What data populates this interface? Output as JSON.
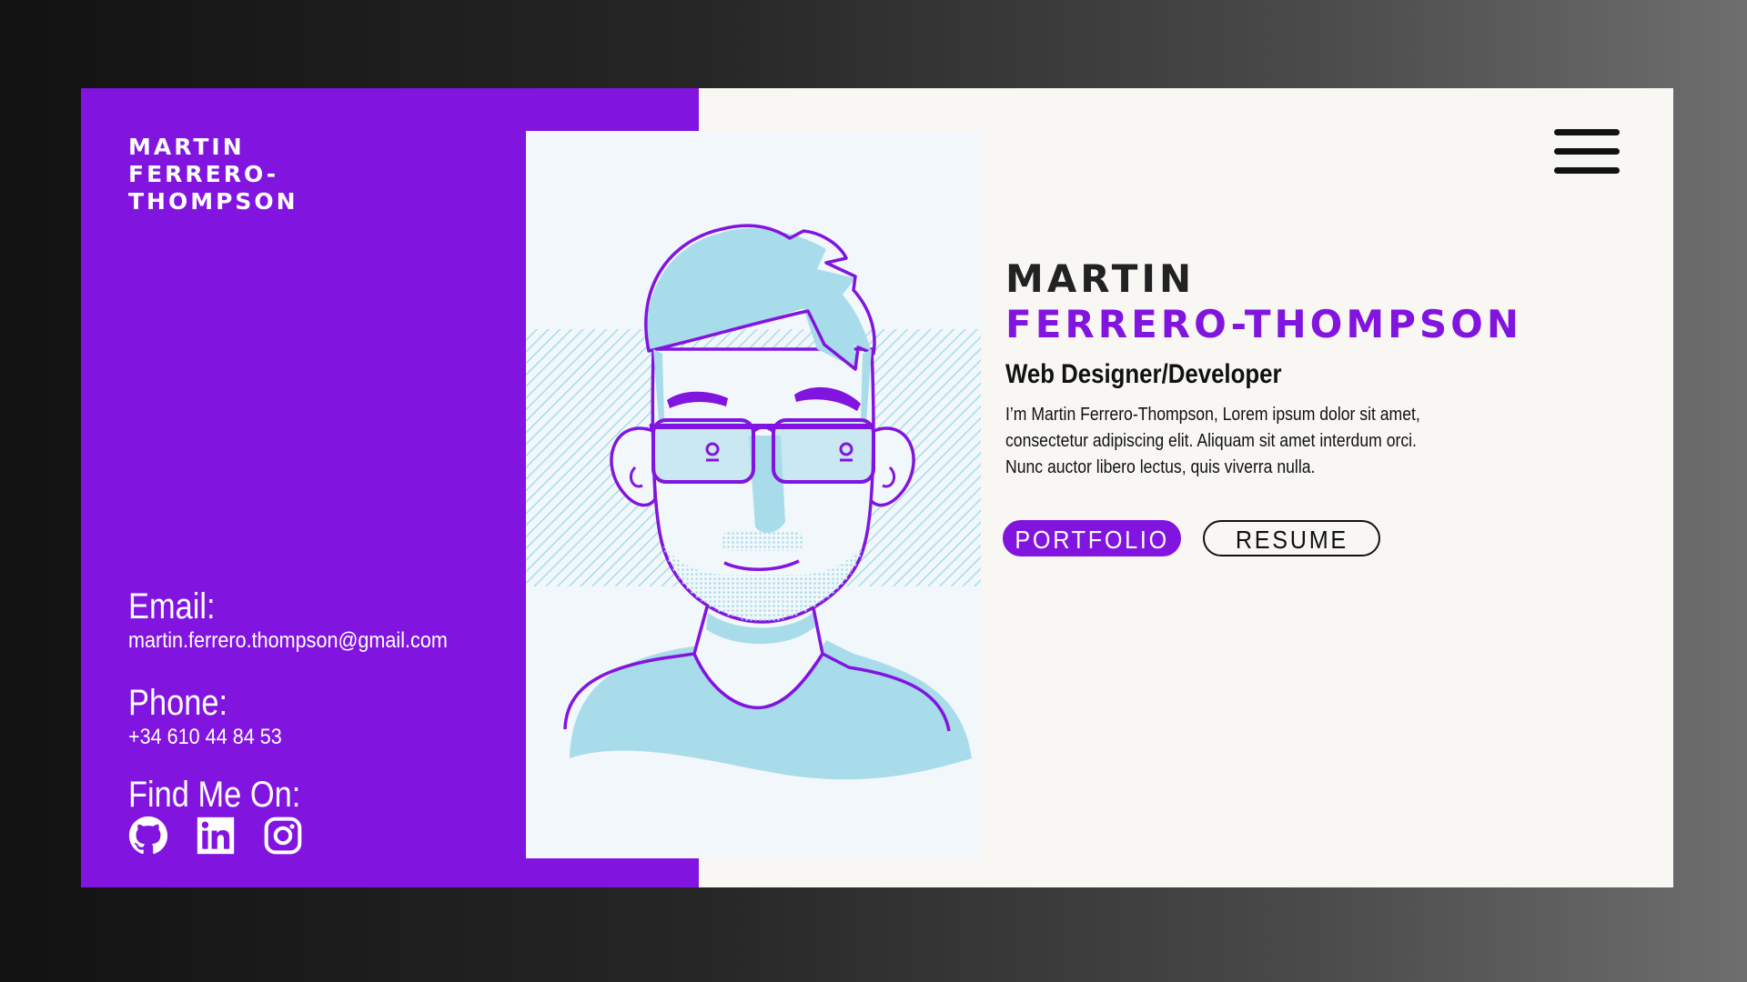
{
  "brand": {
    "name_line1": "MARTIN",
    "name_line2": "FERRERO-",
    "name_line3": "THOMPSON"
  },
  "contact": {
    "email_label": "Email:",
    "email_value": "martin.ferrero.thompson@gmail.com",
    "phone_label": "Phone:",
    "phone_value": "+34 610 44 84 53",
    "find_label": "Find Me On:"
  },
  "social": [
    {
      "icon": "github-icon"
    },
    {
      "icon": "linkedin-icon"
    },
    {
      "icon": "instagram-icon"
    }
  ],
  "hero": {
    "first_name": "MARTIN",
    "last_name": "FERRERO-THOMPSON",
    "job_title": "Web Designer/Developer",
    "bio_line1": "I’m Martin Ferrero-Thompson, Lorem ipsum dolor sit amet,",
    "bio_line2": "consectetur adipiscing elit. Aliquam sit amet interdum orci.",
    "bio_line3": "Nunc auctor libero lectus, quis viverra nulla."
  },
  "buttons": {
    "portfolio_label": "PORTFOLIO",
    "resume_label": "RESUME"
  },
  "menu": {
    "icon": "hamburger-menu-icon"
  },
  "portrait": {
    "icon": "avatar-illustration"
  },
  "colors": {
    "accent": "#8214e0",
    "card_background": "#f8f7f3",
    "portrait_background": "#f1f7fa",
    "illustration_fill": "#a8dcea",
    "text_dark": "#111111"
  }
}
